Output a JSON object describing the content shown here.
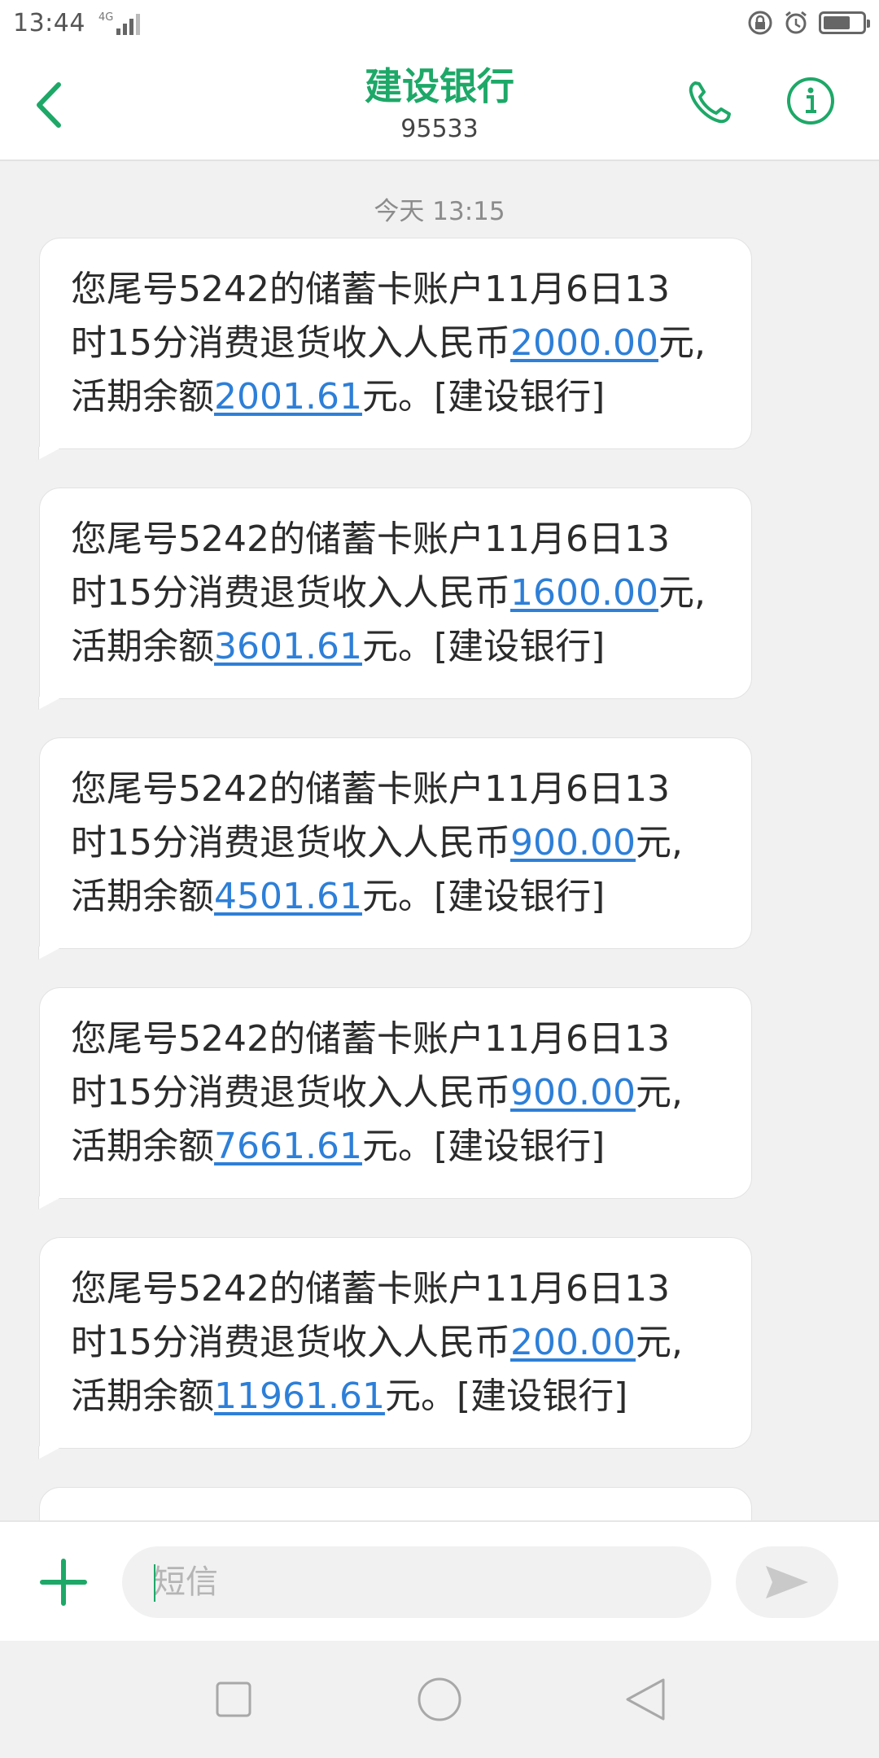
{
  "status_bar": {
    "time": "13:44",
    "network": "4G"
  },
  "header": {
    "title": "建设银行",
    "number": "95533",
    "accent_color": "#1ea868"
  },
  "messages_area": {
    "timestamp": "今天 13:15",
    "messages": [
      {
        "line1": "您尾号5242的储蓄卡账户11月6日13",
        "line2_prefix": "时15分消费退货收入人民币",
        "amount": "2000.00",
        "line2_suffix": "元,",
        "line3_prefix": "活期余额",
        "balance": "2001.61",
        "line3_suffix": "元。[建设银行]"
      },
      {
        "line1": "您尾号5242的储蓄卡账户11月6日13",
        "line2_prefix": "时15分消费退货收入人民币",
        "amount": "1600.00",
        "line2_suffix": "元,",
        "line3_prefix": "活期余额",
        "balance": "3601.61",
        "line3_suffix": "元。[建设银行]"
      },
      {
        "line1": "您尾号5242的储蓄卡账户11月6日13",
        "line2_prefix": "时15分消费退货收入人民币",
        "amount": "900.00",
        "line2_suffix": "元,",
        "line3_prefix": "活期余额",
        "balance": "4501.61",
        "line3_suffix": "元。[建设银行]"
      },
      {
        "line1": "您尾号5242的储蓄卡账户11月6日13",
        "line2_prefix": "时15分消费退货收入人民币",
        "amount": "900.00",
        "line2_suffix": "元,",
        "line3_prefix": "活期余额",
        "balance": "7661.61",
        "line3_suffix": "元。[建设银行]"
      },
      {
        "line1": "您尾号5242的储蓄卡账户11月6日13",
        "line2_prefix": "时15分消费退货收入人民币",
        "amount": "200.00",
        "line2_suffix": "元,",
        "line3_prefix": "活期余额",
        "balance": "11961.61",
        "line3_suffix": "元。[建设银行]"
      }
    ]
  },
  "input_bar": {
    "placeholder": "短信"
  },
  "icons": {
    "back": "chevron-left-icon",
    "call": "phone-icon",
    "info": "info-icon",
    "add": "plus-icon",
    "send": "send-icon",
    "nav_recent": "square-icon",
    "nav_home": "circle-icon",
    "nav_back": "triangle-icon"
  }
}
